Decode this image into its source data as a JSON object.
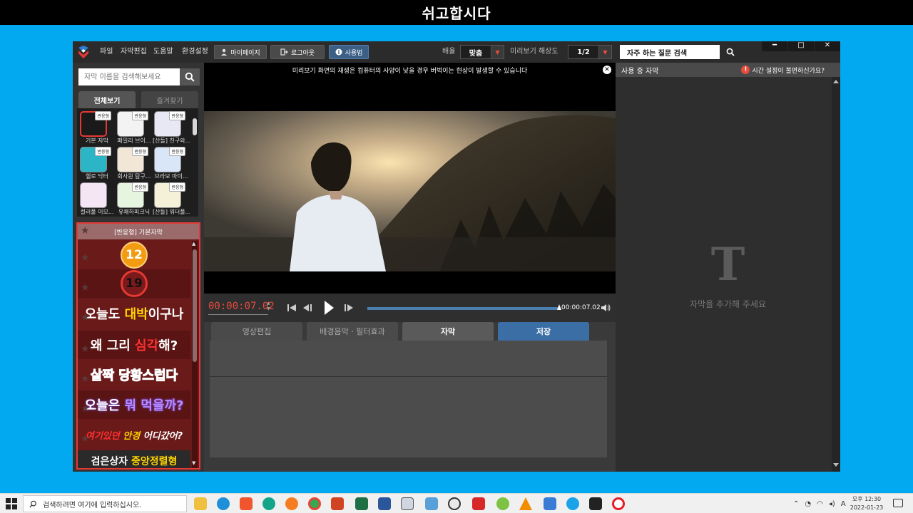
{
  "banner": {
    "title": "쉬고합시다"
  },
  "menubar": {
    "items": [
      "파일",
      "자막편집",
      "도움말",
      "환경설정"
    ],
    "buttons": {
      "mypage": "마이페이지",
      "logout": "로그아웃",
      "usage": "사용법"
    },
    "layout_label": "배율",
    "layout_value": "맞춤",
    "preview_label": "미리보기 해상도",
    "preview_value": "1/2",
    "faq_label": "자주 하는 질문 검색",
    "window_min": "━",
    "window_max": "□",
    "window_close": "✕"
  },
  "left": {
    "search_placeholder": "자막 이름을 검색해보세요",
    "tabs": [
      "전체보기",
      "즐겨찾기"
    ],
    "thumbs": [
      {
        "label": "기본 자막",
        "badge": "반응형",
        "color": "#1a1a1a"
      },
      {
        "label": "패밀리 브이...",
        "badge": "반응형",
        "color": "#f3f3f3"
      },
      {
        "label": "[산돌] 친구와...",
        "badge": "반응형",
        "color": "#e8e8f5"
      },
      {
        "label": "헬로 닥터",
        "badge": "반응형",
        "color": "#2bb5c7"
      },
      {
        "label": "회사원 탐구...",
        "badge": "반응형",
        "color": "#f2e6d6"
      },
      {
        "label": "브라보 마이...",
        "badge": "반응형",
        "color": "#d8e6f7"
      },
      {
        "label": "컬러풀 이모...",
        "badge": "",
        "color": "#f5e6f5"
      },
      {
        "label": "유쾌하피크닉",
        "badge": "반응형",
        "color": "#e6f5e0"
      },
      {
        "label": "[산돌] 워더풀...",
        "badge": "반응형",
        "color": "#f5f0d8"
      }
    ],
    "preset_header": "[반응형] 기본자막",
    "presets": {
      "p12": "12",
      "p19": "19",
      "r1a": "오늘도 ",
      "r1b": "대박",
      "r1c": "이구나",
      "r2a": "왜 그리 ",
      "r2b": "심각",
      "r2c": "해?",
      "r3": "살짝 당황스럽다",
      "r4a": "오늘은 ",
      "r4b": "뭐 먹을까?",
      "r5a": "여기있던 ",
      "r5b": "안경",
      "r5c": " 어디갔어?",
      "r6a": "검은상자 ",
      "r6b": "중앙정렬형"
    }
  },
  "center": {
    "notice": "미리보기 화면의 재생은 컴퓨터의 사양이 낮을 경우 버벅이는 현상이 발생할 수 있습니다",
    "notice_close": "✕",
    "timecode": "00:00:07.02",
    "duration": "00:00:07.02",
    "progress": 1.0,
    "tabs": [
      "영상편집",
      "배경음악 · 필터효과",
      "자막",
      "저장"
    ]
  },
  "right": {
    "title": "사용 중 자막",
    "hint": "시간 설정이 불편하신가요?",
    "hint_icon": "!",
    "empty_icon": "T",
    "empty_text": "자막을 추가해 주세요"
  },
  "taskbar": {
    "search_text": "검색하려면 여기에 입력하십시오.",
    "ime": "A",
    "time": "오후 12:30",
    "date": "2022-01-23"
  }
}
